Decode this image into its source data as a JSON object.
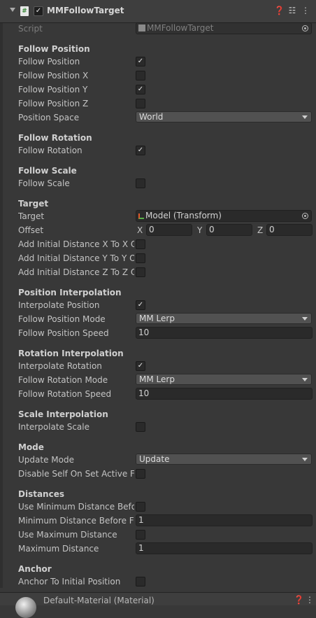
{
  "header": {
    "title": "MMFollowTarget",
    "enabled": true
  },
  "script_row": {
    "label": "Script",
    "value": "MMFollowTarget"
  },
  "follow_position": {
    "section": "Follow Position",
    "rows": [
      {
        "label": "Follow Position",
        "checked": true
      },
      {
        "label": "Follow Position X",
        "checked": false
      },
      {
        "label": "Follow Position Y",
        "checked": true
      },
      {
        "label": "Follow Position Z",
        "checked": false
      }
    ],
    "space_label": "Position Space",
    "space_value": "World"
  },
  "follow_rotation": {
    "section": "Follow Rotation",
    "label": "Follow Rotation",
    "checked": true
  },
  "follow_scale": {
    "section": "Follow Scale",
    "label": "Follow Scale",
    "checked": false
  },
  "target": {
    "section": "Target",
    "target_label": "Target",
    "target_value": "Model (Transform)",
    "offset_label": "Offset",
    "offset": {
      "x_label": "X",
      "x": "0",
      "y_label": "Y",
      "y": "0",
      "z_label": "Z",
      "z": "0"
    },
    "add_rows": [
      {
        "label": "Add Initial Distance X To X Offset",
        "checked": false
      },
      {
        "label": "Add Initial Distance Y To Y Offset",
        "checked": false
      },
      {
        "label": "Add Initial Distance Z To Z Offset",
        "checked": false
      }
    ]
  },
  "position_interpolation": {
    "section": "Position Interpolation",
    "interp_label": "Interpolate Position",
    "interp_checked": true,
    "mode_label": "Follow Position Mode",
    "mode_value": "MM Lerp",
    "speed_label": "Follow Position Speed",
    "speed_value": "10"
  },
  "rotation_interpolation": {
    "section": "Rotation Interpolation",
    "interp_label": "Interpolate Rotation",
    "interp_checked": true,
    "mode_label": "Follow Rotation Mode",
    "mode_value": "MM Lerp",
    "speed_label": "Follow Rotation Speed",
    "speed_value": "10"
  },
  "scale_interpolation": {
    "section": "Scale Interpolation",
    "interp_label": "Interpolate Scale",
    "interp_checked": false
  },
  "mode": {
    "section": "Mode",
    "update_label": "Update Mode",
    "update_value": "Update",
    "disable_label": "Disable Self On Set Active False",
    "disable_checked": false
  },
  "distances": {
    "section": "Distances",
    "use_min_label": "Use Minimum Distance Before Follow",
    "use_min_checked": false,
    "min_label": "Minimum Distance Before Follow",
    "min_value": "1",
    "use_max_label": "Use Maximum Distance",
    "use_max_checked": false,
    "max_label": "Maximum Distance",
    "max_value": "1"
  },
  "anchor": {
    "section": "Anchor",
    "label": "Anchor To Initial Position",
    "checked": false
  },
  "footer": {
    "title": "Default-Material (Material)"
  },
  "colors": {
    "background": "#383838",
    "field": "#2a2a2a",
    "dropdown": "#515151",
    "text": "#c4c4c4"
  }
}
